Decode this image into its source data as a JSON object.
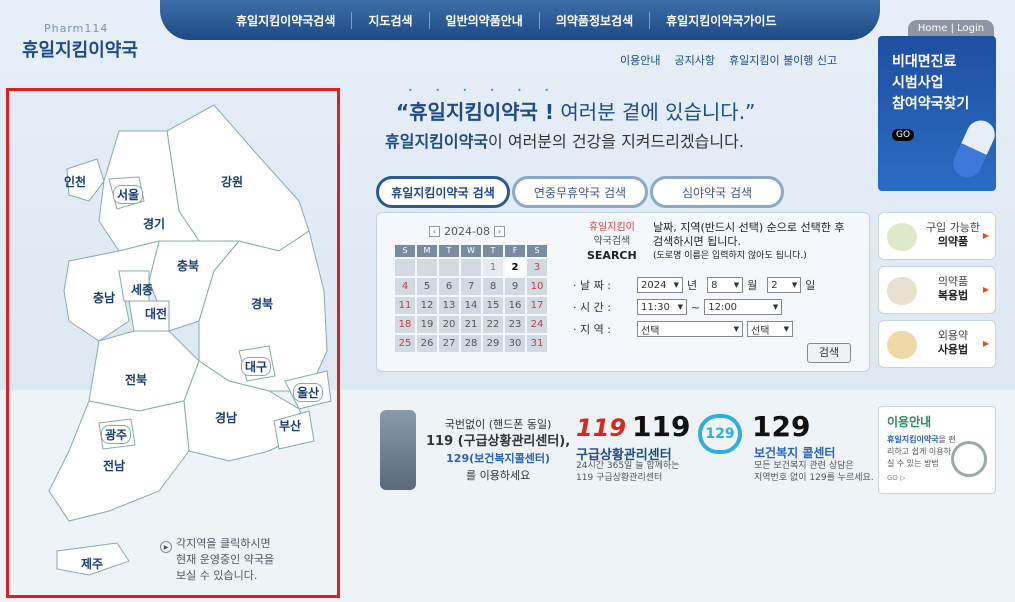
{
  "header": {
    "logo_en": "Pharm114",
    "logo_ko": "휴일지킴이약국",
    "login": "Home | Login"
  },
  "nav": [
    "휴일지킴이약국검색",
    "지도검색",
    "일반의약품안내",
    "의약품정보검색",
    "휴일지킴이약국가이드"
  ],
  "sub_links": [
    "이용안내",
    "공지사항",
    "휴일지킴이 불이행 신고"
  ],
  "slogan": {
    "line1_brand": "“휴일지킴이약국 !",
    "line1_rest": " 여러분 곁에 있습니다.”",
    "line2_brand": "휴일지킴이약국",
    "line2_rest": "이 여러분의 건강을 지켜드리겠습니다."
  },
  "banner": {
    "l1": "비대면진료",
    "l2": "시범사업",
    "l3": "참여약국찾기",
    "go": "GO"
  },
  "tabs": [
    "휴일지킴이약국 검색",
    "연중무휴약국 검색",
    "심야약국 검색"
  ],
  "calendar": {
    "month": "2024-08",
    "dows": [
      "S",
      "M",
      "T",
      "W",
      "T",
      "F",
      "S"
    ],
    "days": [
      "",
      "",
      "",
      "",
      "1",
      "2",
      "3",
      "4",
      "5",
      "6",
      "7",
      "8",
      "9",
      "10",
      "11",
      "12",
      "13",
      "14",
      "15",
      "16",
      "17",
      "18",
      "19",
      "20",
      "21",
      "22",
      "23",
      "24",
      "25",
      "26",
      "27",
      "28",
      "29",
      "30",
      "31"
    ],
    "today": "2"
  },
  "search": {
    "title_red": "휴일지킴이",
    "title_sub": "약국검색",
    "title_en": "SEARCH",
    "desc": "날짜, 지역(반드시 선택) 순으로 선택한 후 검색하시면 됩니다.",
    "note": "(도로명 이름은 입력하지 않아도 됩니다.)",
    "date_label": "· 날 짜 :",
    "year": "2024",
    "year_unit": "년",
    "month": "8",
    "month_unit": "월",
    "day": "2",
    "day_unit": "일",
    "time_label": "· 시 간 :",
    "time_from": "11:30",
    "time_sep": "~",
    "time_to": "12:00",
    "region_label": "· 지 역 :",
    "region1": "선택",
    "region2": "선택",
    "button": "검색"
  },
  "side": [
    {
      "line1": "구입 가능한",
      "line2": "의약품"
    },
    {
      "line1": "의약품",
      "line2": "복용법"
    },
    {
      "line1": "외용약",
      "line2": "사용법"
    }
  ],
  "emergency": {
    "l1": "국번없이 (핸드폰 동일)",
    "l2": "119 (구급상황관리센터),",
    "l3": "129(보건복지콜센터)",
    "l4": "를 이용하세요",
    "e119_logo": "119",
    "e119_num": "119",
    "e119_title": "구급상황관리센터",
    "e119_d1": "24시간 365일 늘 함께하는",
    "e119_d2": "119 구급상황관리센터",
    "e129_logo": "129",
    "e129_num": "129",
    "e129_title": "보건복지 콜센터",
    "e129_d1": "모든 보건복지 관련 상담은",
    "e129_d2": "지역번호 없이 129를 누르세요."
  },
  "guide": {
    "title": "이용안내",
    "brand": "휴일지킴이약국",
    "desc": "을 편리하고 쉽게 이용하실 수 있는 방법",
    "go": "GO ▷"
  },
  "map": {
    "regions": [
      "인천",
      "서울",
      "경기",
      "강원",
      "충북",
      "충남",
      "세종",
      "대전",
      "경북",
      "대구",
      "울산",
      "전북",
      "경남",
      "부산",
      "광주",
      "전남",
      "제주"
    ],
    "hint1": "각지역을 클릭하시면",
    "hint2": "현재 운영중인 약국을",
    "hint3": "보실 수 있습니다."
  }
}
